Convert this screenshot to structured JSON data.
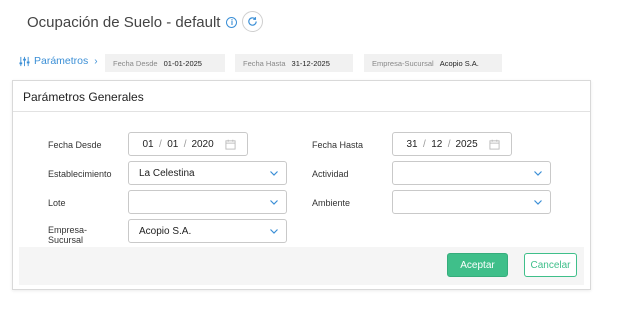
{
  "header": {
    "title": "Ocupación de Suelo - default",
    "info_icon": "i"
  },
  "filters": {
    "params_label": "Parámetros",
    "chips": [
      {
        "key": "Fecha Desde",
        "value": "01-01-2025"
      },
      {
        "key": "Fecha Hasta",
        "value": "31-12-2025"
      },
      {
        "key": "Empresa-Sucursal",
        "value": "Acopio S.A."
      }
    ]
  },
  "panel": {
    "title": "Parámetros Generales",
    "fields": {
      "fecha_desde": {
        "label": "Fecha Desde",
        "day": "01",
        "month": "01",
        "year": "2020"
      },
      "fecha_hasta": {
        "label": "Fecha Hasta",
        "day": "31",
        "month": "12",
        "year": "2025"
      },
      "establecimiento": {
        "label": "Establecimiento",
        "value": "La Celestina"
      },
      "actividad": {
        "label": "Actividad",
        "value": ""
      },
      "lote": {
        "label": "Lote",
        "value": ""
      },
      "ambiente": {
        "label": "Ambiente",
        "value": ""
      },
      "empresa": {
        "label_line1": "Empresa-",
        "label_line2": "Sucursal",
        "value": "Acopio S.A."
      }
    },
    "date_separator": "/",
    "buttons": {
      "accept": "Aceptar",
      "cancel": "Cancelar"
    }
  },
  "colors": {
    "accent": "#3fbf8a",
    "link": "#3b8fd6"
  },
  "icons": [
    "info-icon",
    "refresh-icon",
    "sliders-icon",
    "chevron-right-icon",
    "calendar-icon",
    "chevron-down-icon"
  ]
}
